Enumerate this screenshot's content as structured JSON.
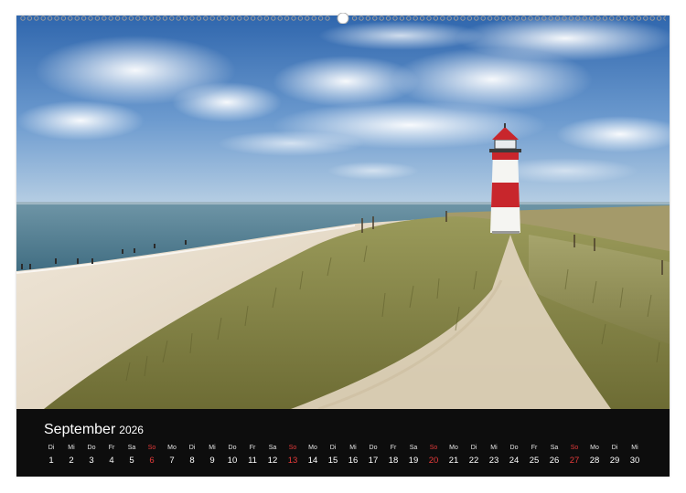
{
  "calendar": {
    "month": "September",
    "year": "2026",
    "accent_color": "#e63b3b",
    "days": [
      {
        "weekday": "Di",
        "day": "1"
      },
      {
        "weekday": "Mi",
        "day": "2"
      },
      {
        "weekday": "Do",
        "day": "3"
      },
      {
        "weekday": "Fr",
        "day": "4"
      },
      {
        "weekday": "Sa",
        "day": "5"
      },
      {
        "weekday": "So",
        "day": "6",
        "sunday": true
      },
      {
        "weekday": "Mo",
        "day": "7"
      },
      {
        "weekday": "Di",
        "day": "8"
      },
      {
        "weekday": "Mi",
        "day": "9"
      },
      {
        "weekday": "Do",
        "day": "10"
      },
      {
        "weekday": "Fr",
        "day": "11"
      },
      {
        "weekday": "Sa",
        "day": "12"
      },
      {
        "weekday": "So",
        "day": "13",
        "sunday": true
      },
      {
        "weekday": "Mo",
        "day": "14"
      },
      {
        "weekday": "Di",
        "day": "15"
      },
      {
        "weekday": "Mi",
        "day": "16"
      },
      {
        "weekday": "Do",
        "day": "17"
      },
      {
        "weekday": "Fr",
        "day": "18"
      },
      {
        "weekday": "Sa",
        "day": "19"
      },
      {
        "weekday": "So",
        "day": "20",
        "sunday": true
      },
      {
        "weekday": "Mo",
        "day": "21"
      },
      {
        "weekday": "Di",
        "day": "22"
      },
      {
        "weekday": "Mi",
        "day": "23"
      },
      {
        "weekday": "Do",
        "day": "24"
      },
      {
        "weekday": "Fr",
        "day": "25"
      },
      {
        "weekday": "Sa",
        "day": "26"
      },
      {
        "weekday": "So",
        "day": "27",
        "sunday": true
      },
      {
        "weekday": "Mo",
        "day": "28"
      },
      {
        "weekday": "Di",
        "day": "29"
      },
      {
        "weekday": "Mi",
        "day": "30"
      }
    ]
  },
  "photo": {
    "subject": "lighthouse-on-dunes",
    "lighthouse_red": "#c8262c",
    "sky_color": "#3f78b8",
    "sea_color": "#4f7d91",
    "sand_color": "#e9dfcf",
    "grass_color": "#8a8a4a"
  }
}
